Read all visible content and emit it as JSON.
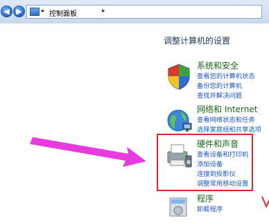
{
  "breadcrumb": {
    "separator": "▸",
    "location": "控制面板"
  },
  "main": {
    "title": "调整计算机的设置"
  },
  "categories": [
    {
      "title": "系统和安全",
      "links": [
        "查看您的计算机状态",
        "备份您的计算机",
        "查找并解决问题"
      ]
    },
    {
      "title": "网络和 Internet",
      "links": [
        "查看网络状态和任务",
        "选择家庭组和共享选项"
      ]
    },
    {
      "title": "硬件和声音",
      "links": [
        "查看设备和打印机",
        "添加设备",
        "连接到投影仪",
        "调整常用移动设置"
      ]
    },
    {
      "title": "程序",
      "links": [
        "卸载程序"
      ]
    }
  ],
  "colors": {
    "highlight_box": "#e82222",
    "annotation_arrow": "#e83adf"
  },
  "icons": {
    "back": "back-arrow-icon",
    "forward": "forward-arrow-icon",
    "location": "control-panel-icon",
    "system_security": "shield-icon",
    "network": "network-globe-icon",
    "hardware_sound": "printer-icon",
    "programs": "program-box-icon"
  }
}
